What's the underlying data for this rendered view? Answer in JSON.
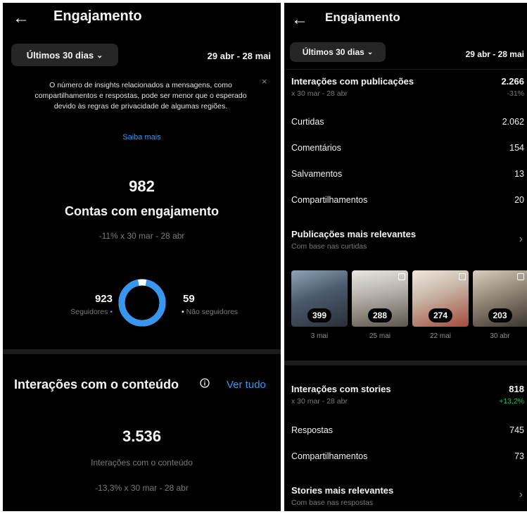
{
  "left": {
    "header": {
      "title": "Engajamento"
    },
    "period": {
      "label": "Últimos 30 dias",
      "range": "29 abr - 28 mai"
    },
    "notice": {
      "text": "O número de insights relacionados a mensagens, como compartilhamentos e respostas, pode ser menor que o esperado devido às regras de privacidade de algumas regiões.",
      "close": "×",
      "link": "Saiba mais"
    },
    "accounts": {
      "value": "982",
      "label": "Contas com engajamento",
      "comparison": "-11% x 30 mar - 28 abr",
      "followers_value": "923",
      "followers_label": "Seguidores",
      "nonfollowers_value": "59",
      "nonfollowers_label": "Não seguidores",
      "follower_share": 0.94
    },
    "content": {
      "title": "Interações com o conteúdo",
      "info_icon": "info-icon",
      "see_all": "Ver tudo",
      "value": "3.536",
      "label": "Interações com o conteúdo",
      "comparison": "-13,3% x 30 mar - 28 abr"
    }
  },
  "right": {
    "header": {
      "title": "Engajamento"
    },
    "period": {
      "label": "Últimos 30 dias",
      "range": "29 abr - 28 mai"
    },
    "post_interactions": {
      "title": "Interações com publicações",
      "value": "2.266",
      "subtitle": "x 30 mar - 28 abr",
      "change": "-31%",
      "rows": [
        {
          "label": "Curtidas",
          "value": "2.062"
        },
        {
          "label": "Comentários",
          "value": "154"
        },
        {
          "label": "Salvamentos",
          "value": "13"
        },
        {
          "label": "Compartilhamentos",
          "value": "20"
        }
      ]
    },
    "top_posts": {
      "title": "Publicações mais relevantes",
      "subtitle": "Com base nas curtidas",
      "posts": [
        {
          "count": "399",
          "date": "3 mai"
        },
        {
          "count": "288",
          "date": "25 mai"
        },
        {
          "count": "274",
          "date": "22 mai"
        },
        {
          "count": "203",
          "date": "30 abr"
        }
      ]
    },
    "story_interactions": {
      "title": "Interações com stories",
      "value": "818",
      "subtitle": "x 30 mar - 28 abr",
      "change": "+13,2%",
      "rows": [
        {
          "label": "Respostas",
          "value": "745"
        },
        {
          "label": "Compartilhamentos",
          "value": "73"
        }
      ]
    },
    "top_stories": {
      "title": "Stories mais relevantes",
      "subtitle": "Com base nas respostas"
    }
  },
  "colors": {
    "background": "#000000",
    "accent_blue": "#3797f0",
    "positive_green": "#2dbf5a",
    "muted_text": "#8e8e8e"
  }
}
